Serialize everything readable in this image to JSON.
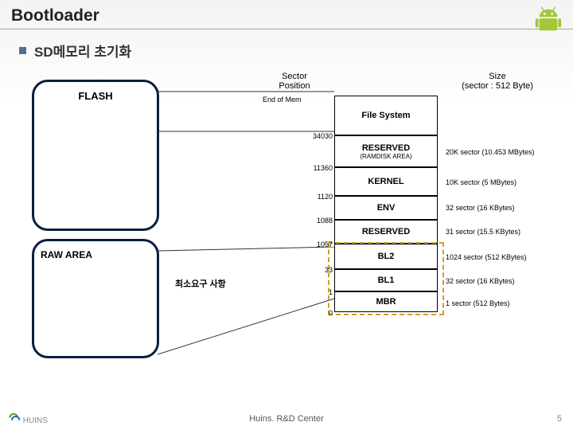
{
  "title": "Bootloader",
  "subtitle": "SD메모리 초기화",
  "left": {
    "flash": "FLASH",
    "raw": "RAW AREA",
    "min_req": "최소요구 사항"
  },
  "headers": {
    "pos": "Sector\nPosition",
    "endmem": "End of Mem",
    "size": "Size\n(sector : 512 Byte)"
  },
  "stack": {
    "fs": "File System",
    "rsv1": "RESERVED",
    "rsv1_sub": "(RAMDISK AREA)",
    "kernel": "KERNEL",
    "env": "ENV",
    "rsv2": "RESERVED",
    "bl2": "BL2",
    "bl1": "BL1",
    "mbr": "MBR"
  },
  "positions": {
    "p34030": "34030",
    "p11360": "11360",
    "p1120": "1120",
    "p1088": "1088",
    "p1057": "1057",
    "p33": "33",
    "p1": "1",
    "p0": "0"
  },
  "sizes": {
    "s20k": "20K sector (10.453 MBytes)",
    "s10k": "10K sector (5 MBytes)",
    "s32": "32 sector (16 KBytes)",
    "s31": "31 sector (15.5 KBytes)",
    "s1024": "1024 sector (512 KBytes)",
    "s32b": "32 sector (16 KBytes)",
    "s1": "1 sector (512 Bytes)"
  },
  "footer": "Huins. R&D Center",
  "page": "5",
  "logo": "HUINS"
}
